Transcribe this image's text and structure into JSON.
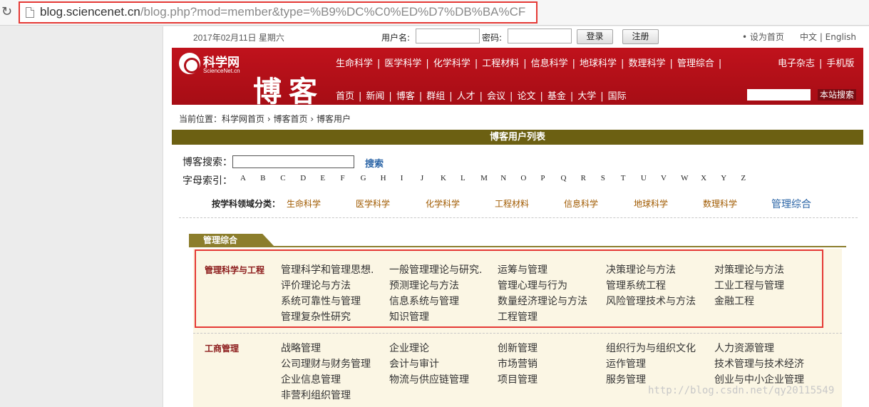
{
  "browser": {
    "url_host": "blog.sciencenet.cn",
    "url_path": "/blog.php?mod=member&type=%B9%DC%C0%ED%D7%DB%BA%CF"
  },
  "topbar": {
    "date": "2017年02月11日 星期六",
    "username_label": "用户名:",
    "password_label": "密码:",
    "login_button": "登录",
    "register_button": "注册",
    "set_home": "• 设为首页",
    "language": "中文 | English"
  },
  "header": {
    "logo_cn": "科学网",
    "logo_en": "ScienceNet.cn",
    "logo_blog": "博客",
    "nav_main": [
      "生命科学",
      "医学科学",
      "化学科学",
      "工程材料",
      "信息科学",
      "地球科学",
      "数理科学",
      "管理综合"
    ],
    "nav_right": [
      "电子杂志",
      "手机版"
    ],
    "nav_secondary": [
      "首页",
      "新闻",
      "博客",
      "群组",
      "人才",
      "会议",
      "论文",
      "基金",
      "大学",
      "国际"
    ],
    "site_search_button": "本站搜索"
  },
  "breadcrumb": {
    "label": "当前位置：",
    "items": [
      "科学网首页",
      "博客首页",
      "博客用户"
    ],
    "separator": "›"
  },
  "list_title": "博客用户列表",
  "blog_search": {
    "label": "博客搜索：",
    "button": "搜索"
  },
  "alphabet": {
    "label": "字母索引：",
    "letters": [
      "A",
      "B",
      "C",
      "D",
      "E",
      "F",
      "G",
      "H",
      "I",
      "J",
      "K",
      "L",
      "M",
      "N",
      "O",
      "P",
      "Q",
      "R",
      "S",
      "T",
      "U",
      "V",
      "W",
      "X",
      "Y",
      "Z"
    ]
  },
  "subjects": {
    "label": "按学科领域分类：",
    "items": [
      "生命科学",
      "医学科学",
      "化学科学",
      "工程材料",
      "信息科学",
      "地球科学",
      "数理科学",
      "管理综合"
    ],
    "current": "管理综合"
  },
  "section": {
    "tab": "管理综合",
    "categories": [
      {
        "title": "管理科学与工程",
        "items": [
          "管理科学和管理思想.",
          "一般管理理论与研究.",
          "运筹与管理",
          "决策理论与方法",
          "对策理论与方法",
          "评价理论与方法",
          "预测理论与方法",
          "管理心理与行为",
          "管理系统工程",
          "工业工程与管理",
          "系统可靠性与管理",
          "信息系统与管理",
          "数量经济理论与方法",
          "风险管理技术与方法",
          "金融工程",
          "管理复杂性研究",
          "知识管理",
          "工程管理"
        ]
      },
      {
        "title": "工商管理",
        "items": [
          "战略管理",
          "企业理论",
          "创新管理",
          "组织行为与组织文化",
          "人力资源管理",
          "公司理财与财务管理",
          "会计与审计",
          "市场营销",
          "运作管理",
          "技术管理与技术经济",
          "企业信息管理",
          "物流与供应链管理",
          "项目管理",
          "服务管理",
          "创业与中小企业管理",
          "非营利组织管理"
        ]
      }
    ]
  },
  "watermark": "http://blog.csdn.net/qy20115549"
}
